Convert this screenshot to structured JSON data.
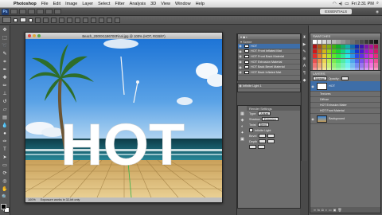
{
  "menubar": {
    "app": "Photoshop",
    "items": [
      "File",
      "Edit",
      "Image",
      "Layer",
      "Select",
      "Filter",
      "Analysis",
      "3D",
      "View",
      "Window",
      "Help"
    ],
    "time": "Fri 2:31 PM"
  },
  "appbar": {
    "logo": "Ps",
    "workspace": "ESSENTIALS"
  },
  "document": {
    "title": "Beach_2000X1186700Final.jpg @ 100% (HOT, RGB/8*)",
    "zoom": "100%",
    "status": "Exposure works in 32-bit only",
    "headline": "HOT"
  },
  "layers_panel": {
    "rows": [
      {
        "label": "HOT",
        "selected": true
      },
      {
        "label": "HOT Front Inflated Mat"
      },
      {
        "label": "HOT Front Back Material"
      },
      {
        "label": "HOT Extrusion Material"
      },
      {
        "label": "HOT Back Bevel Material"
      },
      {
        "label": "HOT Back Inflated Mat"
      },
      {
        "label": "Infinite Light 1"
      },
      {
        "label": "Infinite Light 2"
      }
    ],
    "props": {
      "head": "Render Settings",
      "type_label": "Type:",
      "type_value": "Adjust",
      "shadow_label": "Shadow",
      "shadow_value": "Extrusion",
      "twist_label": "Twist",
      "twist_value": "Bend",
      "extras_label": "Infinite Light",
      "bevel_label": "Bevel",
      "depth_label": "Depth"
    }
  },
  "right_panel": {
    "tab_swatches": "SWATCHES",
    "tab_layers": "LAYERS",
    "blend_mode": "Normal",
    "opacity": "Opacity:",
    "layers": [
      {
        "label": "HOT",
        "selected": true
      },
      {
        "label": "Textures",
        "sub": true
      },
      {
        "label": "Diffuse",
        "sub": true
      },
      {
        "label": "HOT Extrusion Mater",
        "sub": true
      },
      {
        "label": "HOT Front Material",
        "sub": true
      },
      {
        "label": "Background"
      }
    ]
  }
}
